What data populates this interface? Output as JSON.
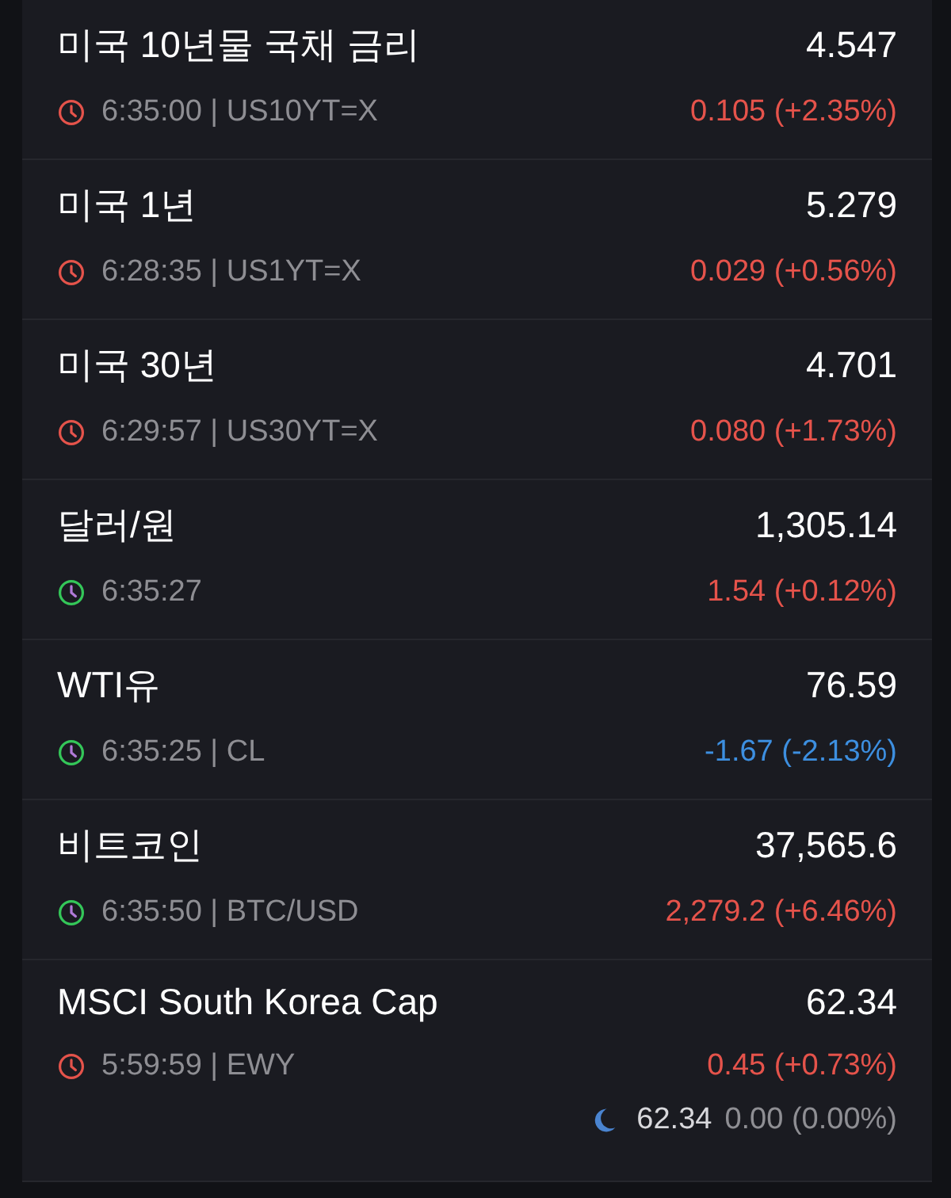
{
  "quotes": [
    {
      "name": "미국 10년물 국채 금리",
      "price": "4.547",
      "meta": "6:35:00 | US10YT=X",
      "market_open": false,
      "change": "0.105 (+2.35%)",
      "color": "#e5534b"
    },
    {
      "name": "미국 1년",
      "price": "5.279",
      "meta": "6:28:35 | US1YT=X",
      "market_open": false,
      "change": "0.029 (+0.56%)",
      "color": "#e5534b"
    },
    {
      "name": "미국 30년",
      "price": "4.701",
      "meta": "6:29:57 | US30YT=X",
      "market_open": false,
      "change": "0.080 (+1.73%)",
      "color": "#e5534b"
    },
    {
      "name": "달러/원",
      "price": "1,305.14",
      "meta": "6:35:27",
      "market_open": true,
      "change": "1.54 (+0.12%)",
      "color": "#e5534b"
    },
    {
      "name": "WTI유",
      "price": "76.59",
      "meta": "6:35:25 | CL",
      "market_open": true,
      "change": "-1.67 (-2.13%)",
      "color": "#3d8fe0"
    },
    {
      "name": "비트코인",
      "price": "37,565.6",
      "meta": "6:35:50 | BTC/USD",
      "market_open": true,
      "change": "2,279.2 (+6.46%)",
      "color": "#e5534b"
    },
    {
      "name": "MSCI South Korea Cap",
      "price": "62.34",
      "meta": "5:59:59 | EWY",
      "market_open": false,
      "change": "0.45 (+0.73%)",
      "color": "#e5534b",
      "after_hours": {
        "price": "62.34",
        "change": "0.00 (0.00%)"
      }
    }
  ]
}
